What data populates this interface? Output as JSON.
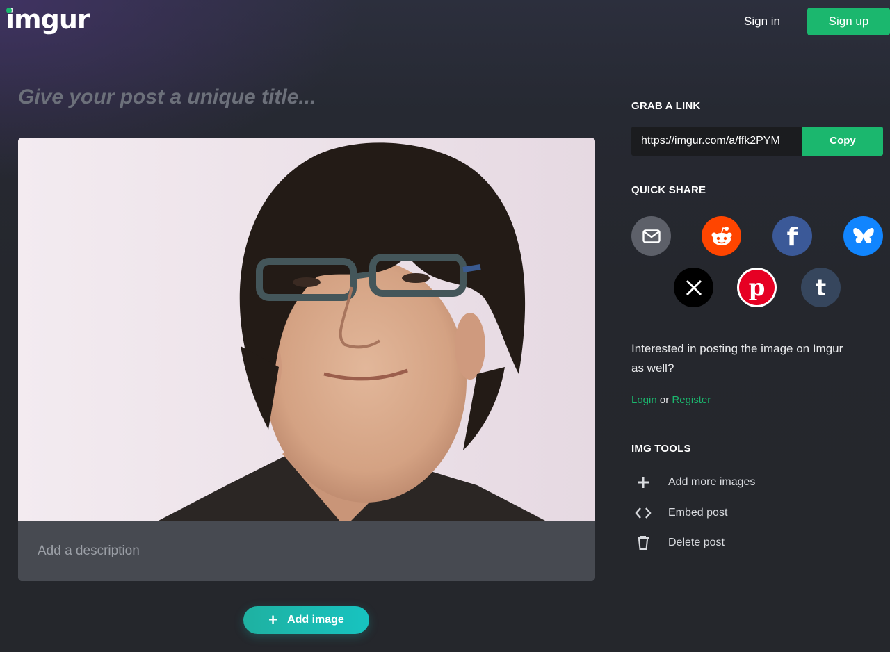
{
  "header": {
    "logo": "imgur",
    "sign_in": "Sign in",
    "sign_up": "Sign up"
  },
  "post": {
    "title_placeholder": "Give your post a unique title...",
    "description_placeholder": "Add a description",
    "add_image_label": "Add image"
  },
  "sidebar": {
    "grab_link_title": "GRAB A LINK",
    "link_url": "https://imgur.com/a/ffk2PYM",
    "copy_label": "Copy",
    "quick_share_title": "QUICK SHARE",
    "share_targets": [
      "email",
      "reddit",
      "facebook",
      "bluesky",
      "x",
      "pinterest",
      "tumblr"
    ],
    "interested_text": "Interested in posting the image on Imgur as well?",
    "login_label": "Login",
    "or_label": "or",
    "register_label": "Register",
    "img_tools_title": "IMG TOOLS",
    "tools": [
      {
        "label": "Add more images",
        "icon": "plus-icon"
      },
      {
        "label": "Embed post",
        "icon": "code-icon"
      },
      {
        "label": "Delete post",
        "icon": "trash-icon"
      }
    ]
  },
  "colors": {
    "brand_green": "#1bb76e",
    "teal_button": "#17c3c0",
    "background": "#25272c",
    "reddit": "#ff4500",
    "facebook": "#3b5998",
    "bluesky": "#1185fe",
    "tumblr": "#36465d"
  }
}
